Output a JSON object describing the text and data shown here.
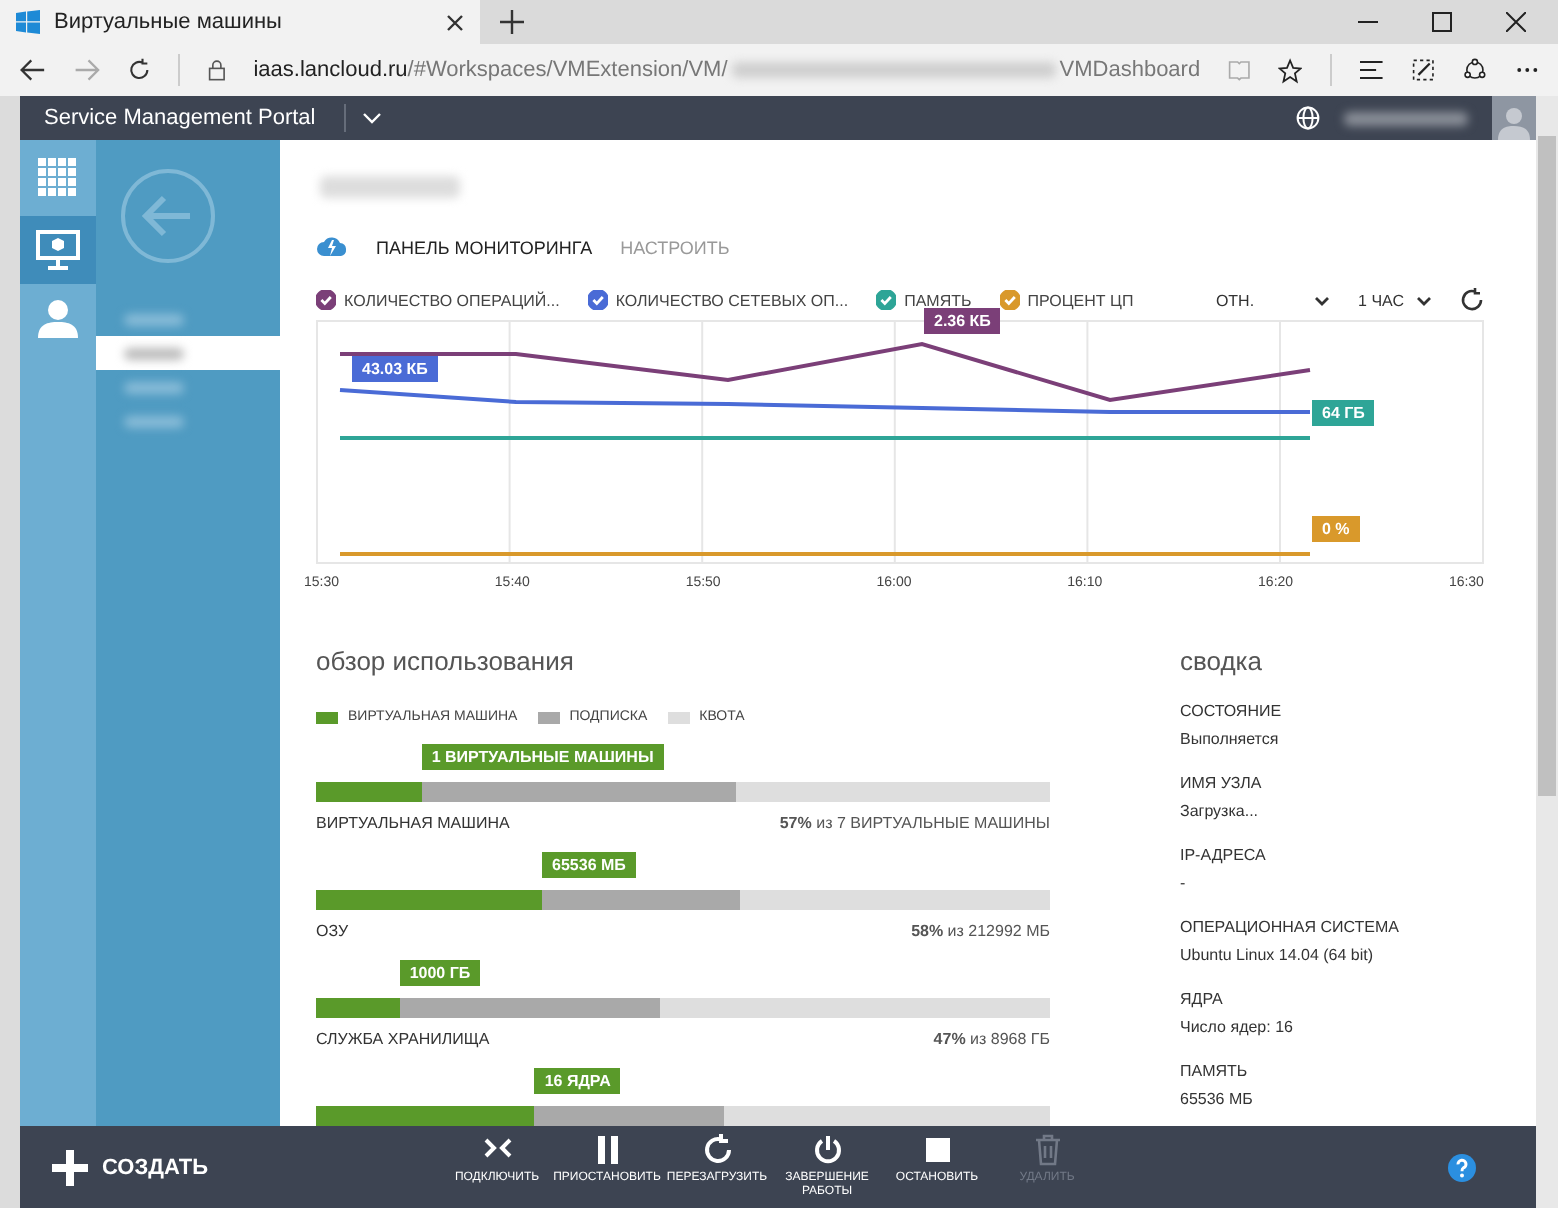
{
  "browser": {
    "tab_title": "Виртуальные машины",
    "url_host": "iaas.lancloud.ru",
    "url_path": "/#Workspaces/VMExtension/VM/",
    "url_tail": "VMDashboard"
  },
  "portal": {
    "title": "Service Management Portal"
  },
  "sidebar": {
    "nav": [
      {
        "kind": "grid",
        "selected": false
      },
      {
        "kind": "monitor",
        "selected": true
      },
      {
        "kind": "user",
        "selected": false
      }
    ],
    "items": [
      {
        "selected": false
      },
      {
        "selected": true
      },
      {
        "selected": false
      },
      {
        "selected": false
      }
    ]
  },
  "tabs": [
    {
      "label": "ПАНЕЛЬ МОНИТОРИНГА",
      "selected": true
    },
    {
      "label": "НАСТРОИТЬ",
      "selected": false
    }
  ],
  "chart": {
    "series": [
      {
        "label": "КОЛИЧЕСТВО ОПЕРАЦИЙ...",
        "color": "#7b3f78",
        "checked": true,
        "callout": "2.36 КБ"
      },
      {
        "label": "КОЛИЧЕСТВО СЕТЕВЫХ ОП...",
        "color": "#4a6bd6",
        "checked": true,
        "callout": "43.03 КБ"
      },
      {
        "label": "ПАМЯТЬ",
        "color": "#2ea597",
        "checked": true,
        "callout": "64 ГБ"
      },
      {
        "label": "ПРОЦЕНТ ЦП",
        "color": "#d9992b",
        "checked": true,
        "callout": "0 %"
      }
    ],
    "mode": "ОТН.",
    "range": "1 ЧАС",
    "xticks": [
      "15:30",
      "15:40",
      "15:50",
      "16:00",
      "16:10",
      "16:20",
      "16:30"
    ]
  },
  "usage": {
    "title": "обзор использования",
    "legend": [
      {
        "label": "ВИРТУАЛЬНАЯ МАШИНА",
        "color": "#5a9a2a"
      },
      {
        "label": "ПОДПИСКА",
        "color": "#a9a9a9"
      },
      {
        "label": "КВОТА",
        "color": "#dedede"
      }
    ],
    "bars": [
      {
        "callout": "1 ВИРТУАЛЬНЫЕ МАШИНЫ",
        "name": "ВИРТУАЛЬНАЯ МАШИНА",
        "reading": "**57%** из 7 ВИРТУАЛЬНЫЕ МАШИНЫ",
        "segments": [
          {
            "level": 0.144
          },
          {
            "level": 0.572
          }
        ]
      },
      {
        "callout": "65536 МБ",
        "name": "ОЗУ",
        "reading": "**58%** из 212992 МБ",
        "segments": [
          {
            "level": 0.308
          },
          {
            "level": 0.578
          }
        ]
      },
      {
        "callout": "1000 ГБ",
        "name": "СЛУЖБА ХРАНИЛИЩА",
        "reading": "**47%** из 8968 ГБ",
        "segments": [
          {
            "level": 0.114
          },
          {
            "level": 0.469
          }
        ]
      },
      {
        "callout": "16 ЯДРА",
        "segments": [
          {
            "level": 0.298
          },
          {
            "level": 0.556
          }
        ]
      }
    ]
  },
  "summary": {
    "title": "сводка",
    "fields": [
      {
        "label": "СОСТОЯНИЕ",
        "value": "Выполняется"
      },
      {
        "label": "ИМЯ УЗЛА",
        "value": "Загрузка..."
      },
      {
        "label": "IP-АДРЕСА",
        "value": "-"
      },
      {
        "label": "ОПЕРАЦИОННАЯ СИСТЕМА",
        "value": "Ubuntu Linux 14.04 (64 bit)"
      },
      {
        "label": "ЯДРА",
        "value": "Число ядер: 16"
      },
      {
        "label": "ПАМЯТЬ",
        "value": "65536 МБ"
      }
    ]
  },
  "toolbar": {
    "create": "СОЗДАТЬ",
    "actions": [
      {
        "kind": "connect",
        "label": "ПОДКЛЮЧИТЬ",
        "disabled": false
      },
      {
        "kind": "pause",
        "label": "ПРИОСТАНОВИТЬ",
        "disabled": false
      },
      {
        "kind": "restart",
        "label": "ПЕРЕЗАГРУЗИТЬ",
        "disabled": false
      },
      {
        "kind": "power",
        "label": "ЗАВЕРШЕНИЕ РАБОТЫ",
        "disabled": false
      },
      {
        "kind": "stop",
        "label": "ОСТАНОВИТЬ",
        "disabled": false
      },
      {
        "kind": "delete",
        "label": "УДАЛИТЬ",
        "disabled": true
      }
    ]
  }
}
